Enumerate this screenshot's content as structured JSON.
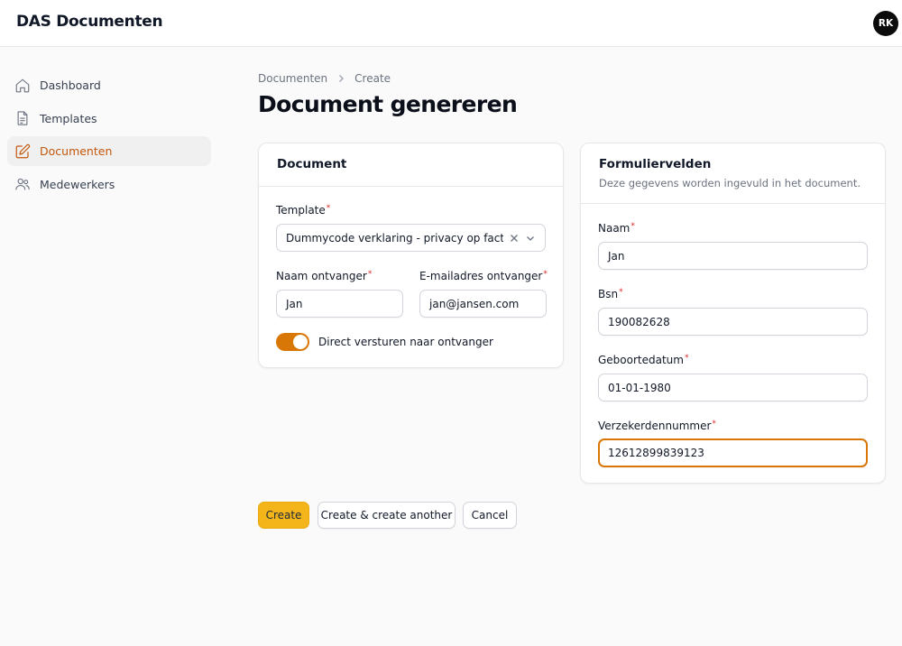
{
  "app": {
    "title": "DAS Documenten",
    "user_initials": "RK"
  },
  "sidebar": {
    "items": [
      {
        "label": "Dashboard",
        "icon": "home-icon",
        "active": false
      },
      {
        "label": "Templates",
        "icon": "document-icon",
        "active": false
      },
      {
        "label": "Documenten",
        "icon": "pencil-square-icon",
        "active": true
      },
      {
        "label": "Medewerkers",
        "icon": "users-icon",
        "active": false
      }
    ]
  },
  "breadcrumb": {
    "parent": "Documenten",
    "current": "Create"
  },
  "page": {
    "title": "Document genereren"
  },
  "document_card": {
    "title": "Document",
    "template_label": "Template",
    "template_value": "Dummycode verklaring - privacy op factuur",
    "name_label": "Naam ontvanger",
    "name_value": "Jan",
    "email_label": "E-mailadres ontvanger",
    "email_value": "jan@jansen.com",
    "toggle_label": "Direct versturen naar ontvanger",
    "toggle_on": true
  },
  "form_card": {
    "title": "Formuliervelden",
    "description": "Deze gegevens worden ingevuld in het document.",
    "fields": [
      {
        "label": "Naam",
        "value": "Jan"
      },
      {
        "label": "Bsn",
        "value": "190082628"
      },
      {
        "label": "Geboortedatum",
        "value": "01-01-1980"
      },
      {
        "label": "Verzekerdennummer",
        "value": "12612899839123"
      }
    ]
  },
  "actions": {
    "create": "Create",
    "create_another": "Create & create another",
    "cancel": "Cancel"
  },
  "colors": {
    "accent": "#d97706",
    "primary_button": "#f4b51a",
    "active_nav": "#c2570c",
    "required": "#dc2626"
  }
}
